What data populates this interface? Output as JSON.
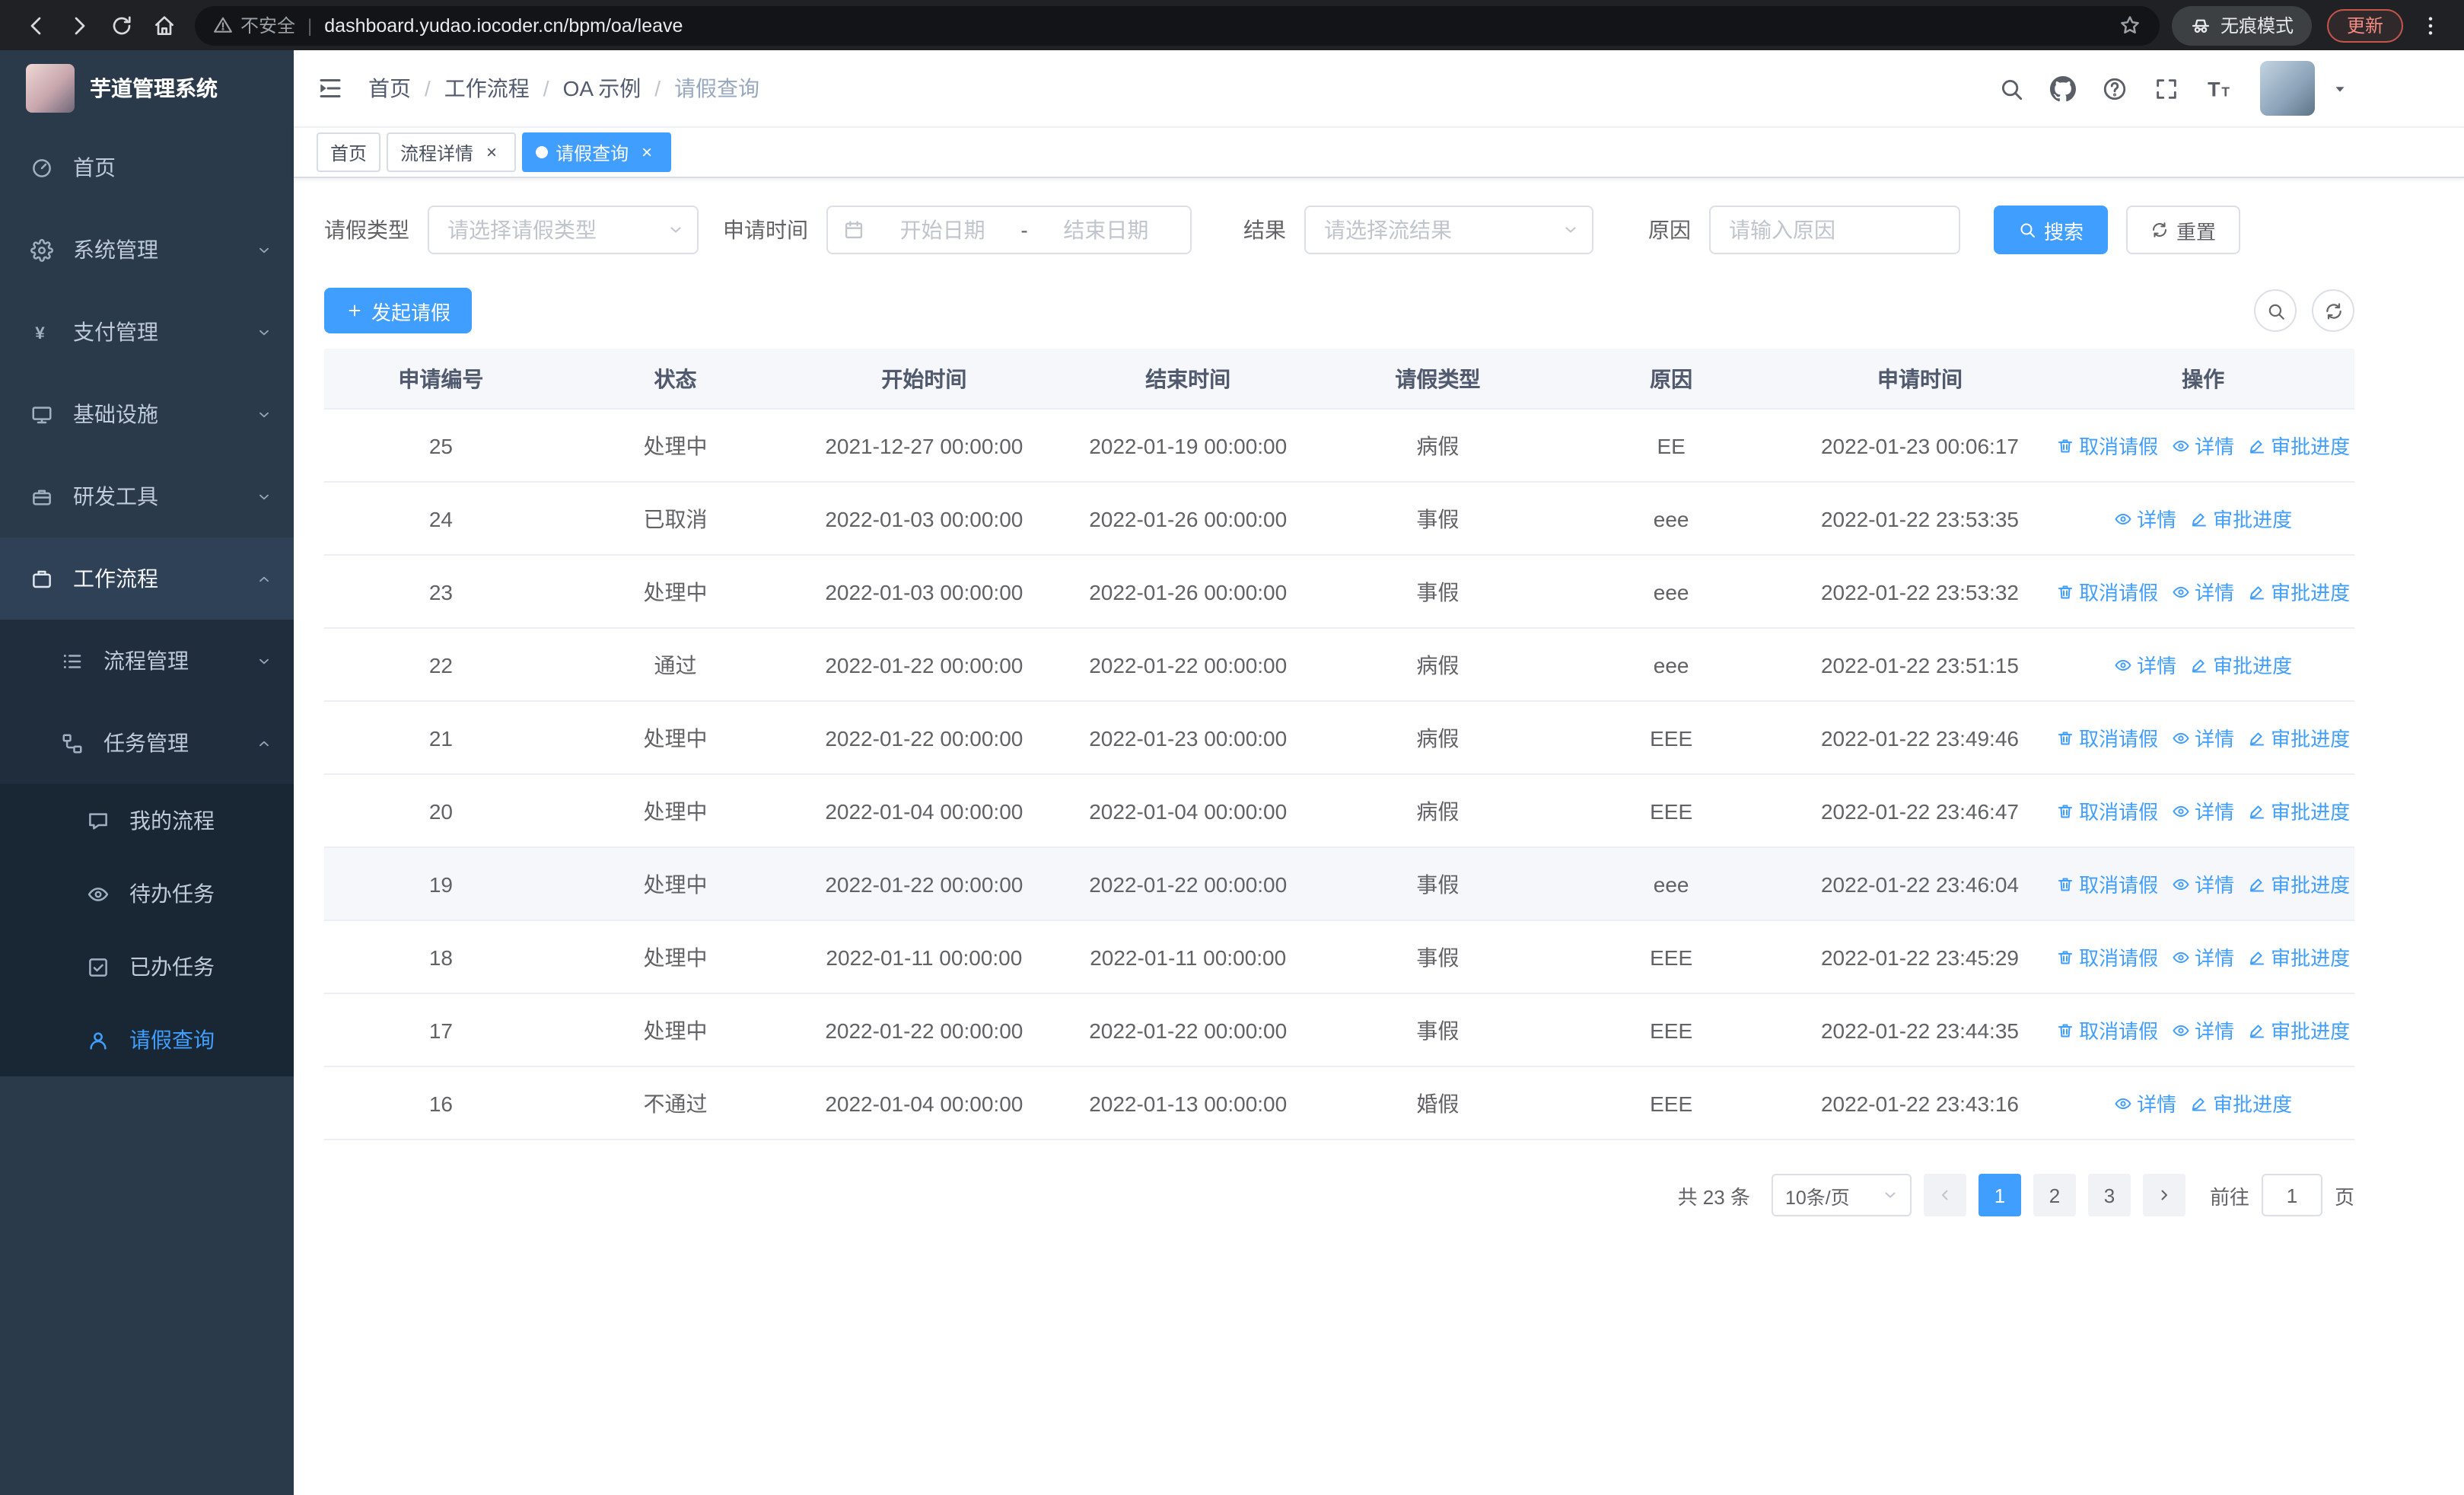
{
  "browser": {
    "security_label": "不安全",
    "url": "dashboard.yudao.iocoder.cn/bpm/oa/leave",
    "incognito_label": "无痕模式",
    "update_label": "更新"
  },
  "ui": {
    "url_separator": "|",
    "breadcrumb_separator": "/",
    "close_glyph": "×"
  },
  "colors": {
    "primary": "#409eff",
    "sidebar_bg": "#2a3a4a",
    "sidebar_submenu_bg": "#1f2d3d"
  },
  "sidebar": {
    "app_title": "芋道管理系统",
    "menu": [
      {
        "name": "home",
        "label": "首页",
        "icon": "dashboard-icon",
        "level": 1
      },
      {
        "name": "system-management",
        "label": "系统管理",
        "icon": "gear-icon",
        "level": 1,
        "arrow": "down"
      },
      {
        "name": "payment-management",
        "label": "支付管理",
        "icon": "yen-icon",
        "level": 1,
        "arrow": "down"
      },
      {
        "name": "infrastructure",
        "label": "基础设施",
        "icon": "monitor-icon",
        "level": 1,
        "arrow": "down"
      },
      {
        "name": "dev-tools",
        "label": "研发工具",
        "icon": "toolbox-icon",
        "level": 1,
        "arrow": "down"
      },
      {
        "name": "workflow",
        "label": "工作流程",
        "icon": "briefcase-icon",
        "level": 1,
        "arrow": "up",
        "open": true
      },
      {
        "name": "process-management",
        "label": "流程管理",
        "icon": "list-icon",
        "level": 2,
        "arrow": "down"
      },
      {
        "name": "task-management",
        "label": "任务管理",
        "icon": "flow-icon",
        "level": 2,
        "arrow": "up",
        "open": true
      },
      {
        "name": "my-processes",
        "label": "我的流程",
        "icon": "chat-icon",
        "level": 3
      },
      {
        "name": "todo-tasks",
        "label": "待办任务",
        "icon": "eye-icon",
        "level": 3
      },
      {
        "name": "done-tasks",
        "label": "已办任务",
        "icon": "done-icon",
        "level": 3
      },
      {
        "name": "leave-query",
        "label": "请假查询",
        "icon": "user-icon",
        "level": 3,
        "active": true
      }
    ]
  },
  "navbar": {
    "breadcrumb": [
      "首页",
      "工作流程",
      "OA 示例",
      "请假查询"
    ]
  },
  "tabs": [
    {
      "name": "home",
      "label": "首页",
      "closable": false,
      "active": false
    },
    {
      "name": "process-detail",
      "label": "流程详情",
      "closable": true,
      "active": false
    },
    {
      "name": "leave-query",
      "label": "请假查询",
      "closable": true,
      "active": true
    }
  ],
  "filters": {
    "leave_type_label": "请假类型",
    "leave_type_placeholder": "请选择请假类型",
    "apply_time_label": "申请时间",
    "start_date_placeholder": "开始日期",
    "range_separator": "-",
    "end_date_placeholder": "结束日期",
    "result_label": "结果",
    "result_placeholder": "请选择流结果",
    "reason_label": "原因",
    "reason_placeholder": "请输入原因",
    "search_button": "搜索",
    "reset_button": "重置"
  },
  "toolbar": {
    "create_label": "发起请假"
  },
  "table": {
    "columns": [
      "申请编号",
      "状态",
      "开始时间",
      "结束时间",
      "请假类型",
      "原因",
      "申请时间",
      "操作"
    ],
    "action_labels": {
      "cancel": "取消请假",
      "detail": "详情",
      "progress": "审批进度"
    },
    "rows": [
      {
        "id": "25",
        "status": "处理中",
        "start": "2021-12-27 00:00:00",
        "end": "2022-01-19 00:00:00",
        "type": "病假",
        "reason": "EE",
        "apply_time": "2022-01-23 00:06:17",
        "actions": [
          "cancel",
          "detail",
          "progress"
        ]
      },
      {
        "id": "24",
        "status": "已取消",
        "start": "2022-01-03 00:00:00",
        "end": "2022-01-26 00:00:00",
        "type": "事假",
        "reason": "eee",
        "apply_time": "2022-01-22 23:53:35",
        "actions": [
          "detail",
          "progress"
        ]
      },
      {
        "id": "23",
        "status": "处理中",
        "start": "2022-01-03 00:00:00",
        "end": "2022-01-26 00:00:00",
        "type": "事假",
        "reason": "eee",
        "apply_time": "2022-01-22 23:53:32",
        "actions": [
          "cancel",
          "detail",
          "progress"
        ]
      },
      {
        "id": "22",
        "status": "通过",
        "start": "2022-01-22 00:00:00",
        "end": "2022-01-22 00:00:00",
        "type": "病假",
        "reason": "eee",
        "apply_time": "2022-01-22 23:51:15",
        "actions": [
          "detail",
          "progress"
        ]
      },
      {
        "id": "21",
        "status": "处理中",
        "start": "2022-01-22 00:00:00",
        "end": "2022-01-23 00:00:00",
        "type": "病假",
        "reason": "EEE",
        "apply_time": "2022-01-22 23:49:46",
        "actions": [
          "cancel",
          "detail",
          "progress"
        ]
      },
      {
        "id": "20",
        "status": "处理中",
        "start": "2022-01-04 00:00:00",
        "end": "2022-01-04 00:00:00",
        "type": "病假",
        "reason": "EEE",
        "apply_time": "2022-01-22 23:46:47",
        "actions": [
          "cancel",
          "detail",
          "progress"
        ]
      },
      {
        "id": "19",
        "status": "处理中",
        "start": "2022-01-22 00:00:00",
        "end": "2022-01-22 00:00:00",
        "type": "事假",
        "reason": "eee",
        "apply_time": "2022-01-22 23:46:04",
        "actions": [
          "cancel",
          "detail",
          "progress"
        ],
        "highlighted": true
      },
      {
        "id": "18",
        "status": "处理中",
        "start": "2022-01-11 00:00:00",
        "end": "2022-01-11 00:00:00",
        "type": "事假",
        "reason": "EEE",
        "apply_time": "2022-01-22 23:45:29",
        "actions": [
          "cancel",
          "detail",
          "progress"
        ]
      },
      {
        "id": "17",
        "status": "处理中",
        "start": "2022-01-22 00:00:00",
        "end": "2022-01-22 00:00:00",
        "type": "事假",
        "reason": "EEE",
        "apply_time": "2022-01-22 23:44:35",
        "actions": [
          "cancel",
          "detail",
          "progress"
        ]
      },
      {
        "id": "16",
        "status": "不通过",
        "start": "2022-01-04 00:00:00",
        "end": "2022-01-13 00:00:00",
        "type": "婚假",
        "reason": "EEE",
        "apply_time": "2022-01-22 23:43:16",
        "actions": [
          "detail",
          "progress"
        ]
      }
    ]
  },
  "pagination": {
    "total_label": "共 23 条",
    "page_size_label": "10条/页",
    "pages": [
      "1",
      "2",
      "3"
    ],
    "active_page": "1",
    "goto_label": "前往",
    "goto_value": "1",
    "unit_label": "页"
  }
}
